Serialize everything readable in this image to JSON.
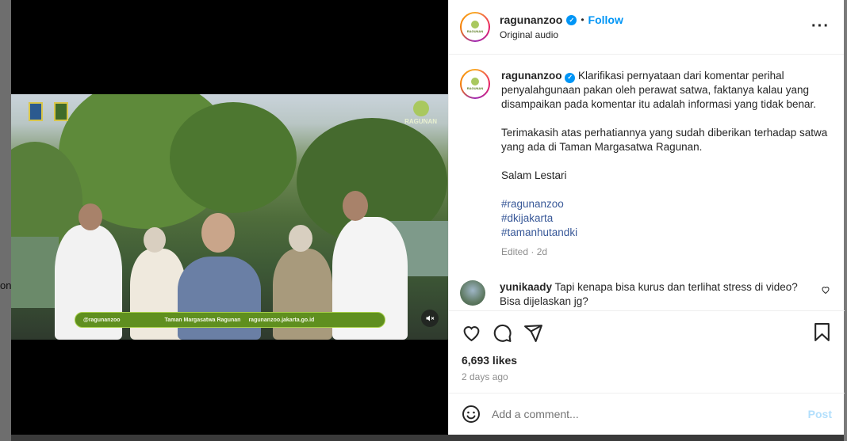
{
  "post": {
    "username": "ragunanzoo",
    "follow_label": "Follow",
    "separator": "•",
    "audio": "Original audio",
    "more": "···",
    "avatar_text": "RAGUNAN"
  },
  "caption": {
    "username": "ragunanzoo",
    "paragraph1": "Klarifikasi pernyataan dari komentar perihal penyalahgunaan pakan oleh perawat satwa, faktanya kalau yang disampaikan pada komentar itu adalah informasi yang tidak benar.",
    "paragraph2": "Terimakasih atas perhatiannya yang sudah diberikan terhadap satwa yang ada di Taman Margasatwa Ragunan.",
    "paragraph3": "Salam Lestari",
    "hashtags": [
      "#ragunanzoo",
      "#dkijakarta",
      "#tamanhutandki"
    ],
    "meta": "Edited · 2d"
  },
  "comment": {
    "username": "yunikaady",
    "text": "Tapi kenapa bisa kurus dan terlihat stress di video? Bisa dijelaskan jg?"
  },
  "engagement": {
    "likes": "6,693 likes",
    "date": "2 days ago"
  },
  "add_comment": {
    "placeholder": "Add a comment...",
    "post_label": "Post"
  },
  "video": {
    "banner_handle": "@ragunanzoo",
    "banner_name": "Taman Margasatwa Ragunan",
    "banner_url": "ragunanzoo.jakarta.go.id",
    "watermark": "RAGUNAN"
  },
  "background": {
    "side_text": "ons"
  },
  "colors": {
    "accent": "#0095f6",
    "hashtag": "#385898",
    "banner": "#5f8f1f"
  }
}
